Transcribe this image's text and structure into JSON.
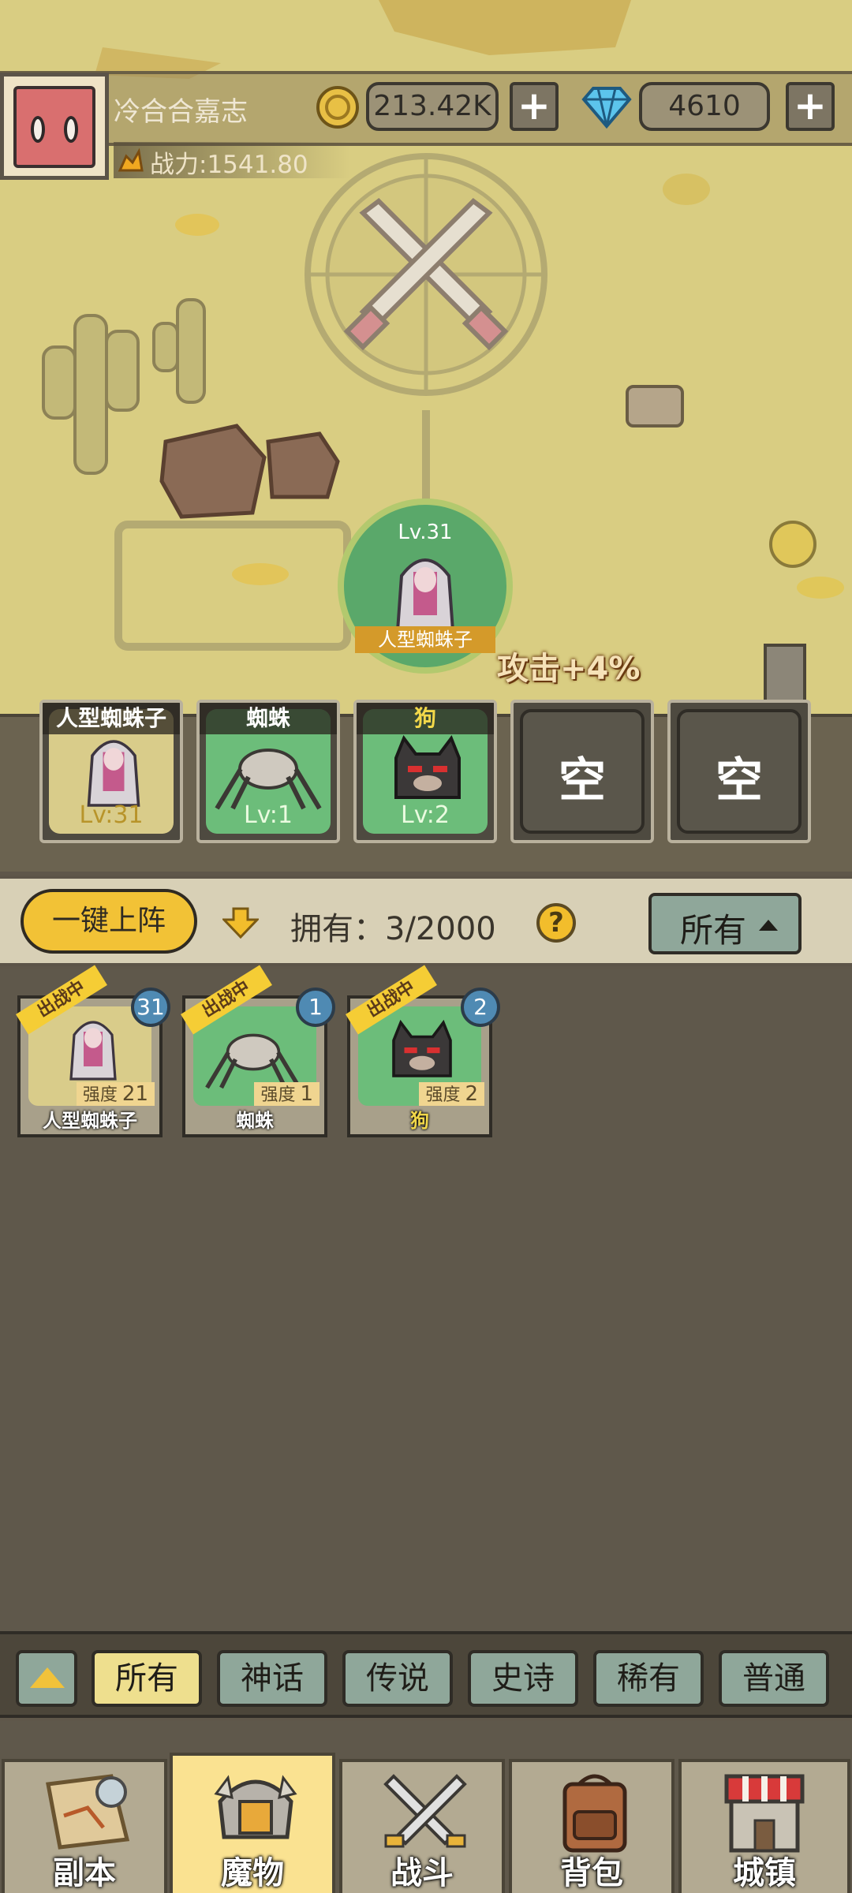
{
  "player": {
    "name": "冷合合嘉志",
    "power": "战力:1541.80",
    "gold": "213.42K",
    "gems": "4610"
  },
  "battle": {
    "leader_level": "Lv.31",
    "leader_name": "人型蜘蛛子",
    "buff_text": "攻击+4%"
  },
  "formation": [
    {
      "name": "人型蜘蛛子",
      "level": "Lv:31"
    },
    {
      "name": "蜘蛛",
      "level": "Lv:1"
    },
    {
      "name": "狗",
      "level": "Lv:2"
    },
    {
      "empty": "空"
    },
    {
      "empty": "空"
    }
  ],
  "toolbar": {
    "deploy_label": "一键上阵",
    "own_label": "拥有：3/2000",
    "help": "?",
    "filter_label": "所有"
  },
  "inventory": [
    {
      "name": "人型蜘蛛子",
      "tag": "出战中",
      "strength_label": "强度",
      "strength": "21",
      "badge": "31",
      "bg": "#d9cc8a"
    },
    {
      "name": "蜘蛛",
      "tag": "出战中",
      "strength_label": "强度",
      "strength": "1",
      "badge": "1",
      "bg": "#6cbd7a"
    },
    {
      "name": "狗",
      "tag": "出战中",
      "strength_label": "强度",
      "strength": "2",
      "badge": "2",
      "bg": "#6cbd7a"
    }
  ],
  "rarity_tabs": [
    "所有",
    "神话",
    "传说",
    "史诗",
    "稀有",
    "普通"
  ],
  "nav": [
    "副本",
    "魔物",
    "战斗",
    "背包",
    "城镇"
  ],
  "colors": {
    "map": "#d9cd82",
    "gold_accent": "#f2c236",
    "legend_green": "#6cbd7a",
    "panel_dark": "#5f584b"
  }
}
